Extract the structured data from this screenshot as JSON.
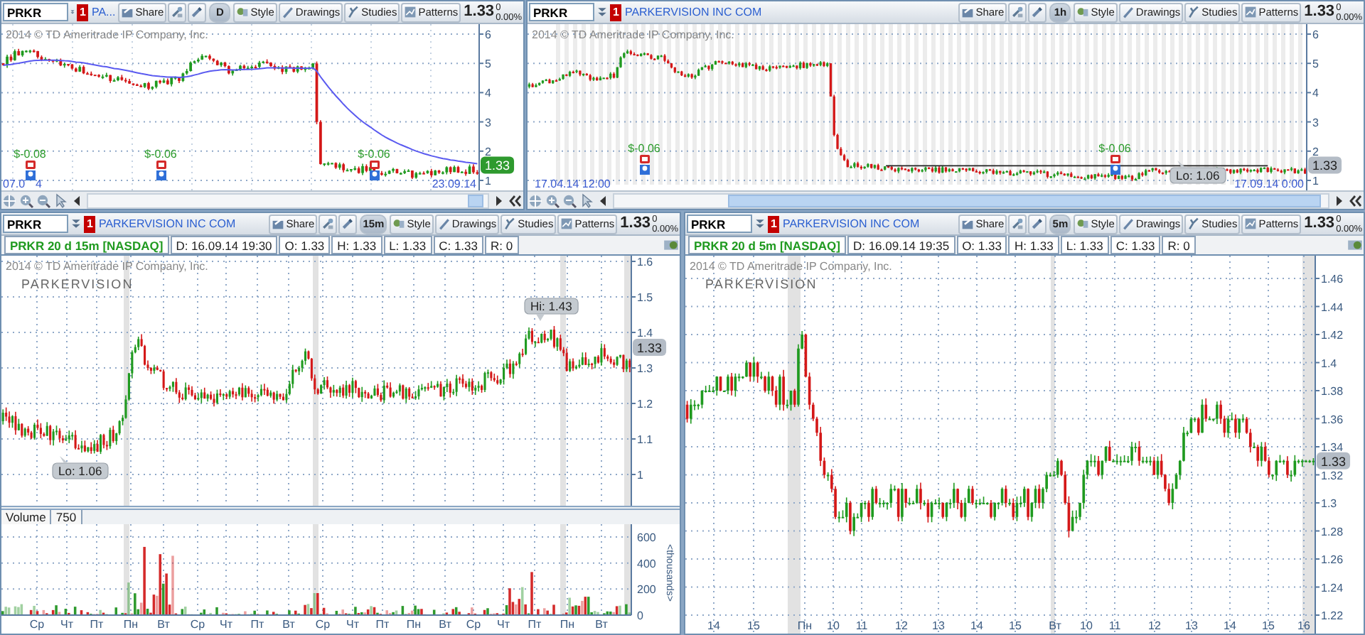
{
  "panes": [
    {
      "kind": "overview",
      "symbol": "PRKR",
      "alert_count": "1",
      "company": "PA...",
      "tools": [
        {
          "kind": "share",
          "label": "Share"
        },
        {
          "kind": "gear"
        },
        {
          "kind": "pencil"
        },
        {
          "kind": "timeframe",
          "label": "D"
        },
        {
          "kind": "style",
          "label": "Style"
        },
        {
          "kind": "drawings",
          "label": "Drawings"
        },
        {
          "kind": "studies",
          "label": "Studies"
        },
        {
          "kind": "patterns",
          "label": "Patterns"
        }
      ],
      "last": "1.33",
      "change": "0",
      "change_percent": "0.00%",
      "chart": {
        "copyright": "2014 © TD Ameritrade IP Company, Inc.",
        "y_ticks": [
          "6",
          "5",
          "4",
          "3",
          "2",
          "1"
        ],
        "events": [
          {
            "text": "$-0.08"
          },
          {
            "text": "$-0.06"
          },
          {
            "text": "$-0.06"
          }
        ],
        "dates": [
          "07.0",
          "4",
          "23.09.14"
        ],
        "badge": {
          "text": "1.33",
          "color": "#2e9a2e"
        }
      }
    },
    {
      "kind": "overview",
      "symbol": "PRKR",
      "alert_count": "1",
      "company": "PARKERVISION INC COM",
      "tools": [
        {
          "kind": "share",
          "label": "Share"
        },
        {
          "kind": "gear"
        },
        {
          "kind": "pencil"
        },
        {
          "kind": "timeframe",
          "label": "1h"
        },
        {
          "kind": "style",
          "label": "Style"
        },
        {
          "kind": "drawings",
          "label": "Drawings"
        },
        {
          "kind": "studies",
          "label": "Studies"
        },
        {
          "kind": "patterns",
          "label": "Patterns"
        }
      ],
      "last": "1.33",
      "change": "0",
      "change_percent": "0.00%",
      "chart": {
        "copyright": "2014 © TD Ameritrade IP Company, Inc.",
        "y_ticks": [
          "6",
          "5",
          "4",
          "3",
          "2",
          "1"
        ],
        "events": [
          {
            "text": "$-0.06"
          },
          {
            "text": "$-0.06"
          }
        ],
        "dates": [
          "17.04.14 12:00",
          "17.09.14 0:00"
        ],
        "callouts": [
          {
            "kind": "lo",
            "text": "Lo: 1.06"
          }
        ],
        "badge": {
          "text": "1.33",
          "color": "#b4bcc6"
        }
      }
    },
    {
      "kind": "intraday",
      "symbol": "PRKR",
      "alert_count": "1",
      "company": "PARKERVISION INC COM",
      "tools": [
        {
          "kind": "share",
          "label": "Share"
        },
        {
          "kind": "gear"
        },
        {
          "kind": "pencil"
        },
        {
          "kind": "timeframe",
          "label": "15m"
        },
        {
          "kind": "style",
          "label": "Style"
        },
        {
          "kind": "drawings",
          "label": "Drawings"
        },
        {
          "kind": "studies",
          "label": "Studies"
        },
        {
          "kind": "patterns",
          "label": "Patterns"
        }
      ],
      "last": "1.33",
      "change": "0",
      "change_percent": "0.00%",
      "info": {
        "title": "PRKR 20 d 15m [NASDAQ]",
        "fields": [
          "D: 16.09.14 19:30",
          "O: 1.33",
          "H: 1.33",
          "L: 1.33",
          "C: 1.33",
          "R: 0"
        ]
      },
      "chart": {
        "copyright": "2014 © TD Ameritrade IP Company, Inc.",
        "logo": "PARKERVISION",
        "y_ticks": [
          "1.6",
          "1.5",
          "1.4",
          "1.3",
          "1.2",
          "1.1",
          "1"
        ],
        "callouts": [
          {
            "kind": "hi",
            "text": "Hi: 1.43"
          },
          {
            "kind": "lo",
            "text": "Lo: 1.06"
          }
        ],
        "badge": {
          "text": "1.33",
          "color": "#b4bcc6"
        }
      },
      "volume": {
        "label": "Volume",
        "value": "750",
        "y_ticks": [
          "600",
          "400",
          "200",
          "0"
        ],
        "unit": "<thousands>"
      },
      "x_labels": [
        "Ср",
        "Чт",
        "Пт",
        "Пн",
        "Вт",
        "Ср",
        "Чт",
        "Пт",
        "Вт",
        "Ср",
        "Чт",
        "Пт",
        "Пн",
        "Вт",
        "Ср",
        "Чт",
        "Пт",
        "Пн",
        "Вт"
      ]
    },
    {
      "kind": "intraday",
      "symbol": "PRKR",
      "alert_count": "1",
      "company": "PARKERVISION INC COM",
      "tools": [
        {
          "kind": "share",
          "label": "Share"
        },
        {
          "kind": "gear"
        },
        {
          "kind": "pencil"
        },
        {
          "kind": "timeframe",
          "label": "5m"
        },
        {
          "kind": "style",
          "label": "Style"
        },
        {
          "kind": "drawings",
          "label": "Drawings"
        },
        {
          "kind": "studies",
          "label": "Studies"
        },
        {
          "kind": "patterns",
          "label": "Patterns"
        }
      ],
      "last": "1.33",
      "change": "0",
      "change_percent": "0.00%",
      "info": {
        "title": "PRKR 20 d 5m [NASDAQ]",
        "fields": [
          "D: 16.09.14 19:35",
          "O: 1.33",
          "H: 1.33",
          "L: 1.33",
          "C: 1.33",
          "R: 0"
        ]
      },
      "chart": {
        "copyright": "2014 © TD Ameritrade IP Company, Inc.",
        "logo": "PARKERVISION",
        "y_ticks": [
          "1.46",
          "1.44",
          "1.42",
          "1.4",
          "1.38",
          "1.36",
          "1.34",
          "1.32",
          "1.3",
          "1.28",
          "1.26",
          "1.24",
          "1.22"
        ],
        "badge": {
          "text": "1.33",
          "color": "#b4bcc6"
        }
      },
      "x_labels": [
        "14",
        "15",
        "Пн",
        "10",
        "11",
        "12",
        "13",
        "14",
        "15",
        "Вт",
        "10",
        "11",
        "12",
        "13",
        "14",
        "15",
        "16"
      ]
    }
  ]
}
